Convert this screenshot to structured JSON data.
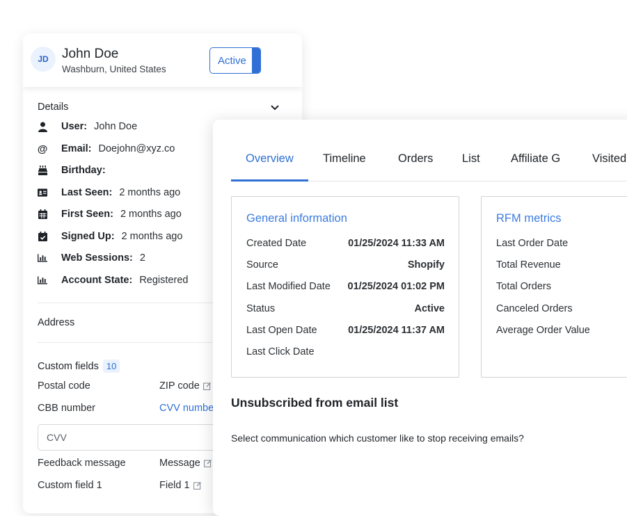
{
  "customer": {
    "initials": "JD",
    "name": "John Doe",
    "location": "Washburn, United States",
    "status": "Active"
  },
  "details": {
    "title": "Details",
    "rows": [
      {
        "icon": "user-icon",
        "label": "User:",
        "value": "John Doe"
      },
      {
        "icon": "at-icon",
        "label": "Email:",
        "value": "Doejohn@xyz.co"
      },
      {
        "icon": "cake-icon",
        "label": "Birthday:",
        "value": ""
      },
      {
        "icon": "id-card-icon",
        "label": "Last Seen:",
        "value": "2 months ago"
      },
      {
        "icon": "calendar-icon",
        "label": "First Seen:",
        "value": "2 months ago"
      },
      {
        "icon": "calendar-check-icon",
        "label": "Signed Up:",
        "value": "2 months ago"
      },
      {
        "icon": "bar-chart-icon",
        "label": "Web Sessions:",
        "value": "2"
      },
      {
        "icon": "bar-chart-icon",
        "label": "Account State:",
        "value": "Registered"
      }
    ]
  },
  "address": {
    "title": "Address"
  },
  "custom_fields": {
    "title": "Custom fields",
    "count": "10",
    "rows": [
      {
        "key": "Postal code",
        "value": "ZIP code"
      },
      {
        "key": "CBB number",
        "value": "CVV number"
      },
      {
        "key": "Feedback message",
        "value": "Message"
      },
      {
        "key": "Custom field 1",
        "value": "Field 1"
      }
    ],
    "cvv_placeholder": "CVV"
  },
  "tabs": [
    "Overview",
    "Timeline",
    "Orders",
    "List",
    "Affiliate G",
    "Visited"
  ],
  "general": {
    "title": "General information",
    "rows": [
      {
        "label": "Created Date",
        "value": "01/25/2024 11:33 AM"
      },
      {
        "label": "Source",
        "value": "Shopify"
      },
      {
        "label": "Last Modified Date",
        "value": "01/25/2024 01:02 PM"
      },
      {
        "label": "Status",
        "value": "Active"
      },
      {
        "label": "Last Open Date",
        "value": "01/25/2024 11:37 AM"
      },
      {
        "label": "Last Click Date",
        "value": ""
      }
    ]
  },
  "rfm": {
    "title": "RFM metrics",
    "rows": [
      {
        "label": "Last Order Date"
      },
      {
        "label": "Total Revenue"
      },
      {
        "label": "Total Orders"
      },
      {
        "label": "Canceled Orders"
      },
      {
        "label": "Average Order Value"
      }
    ]
  },
  "unsubscribe": {
    "title": "Unsubscribed from email list",
    "question": "Select communication which customer like to stop receiving emails?"
  },
  "colors": {
    "accent": "#2f6fd6",
    "section_title": "#3c7be0"
  }
}
